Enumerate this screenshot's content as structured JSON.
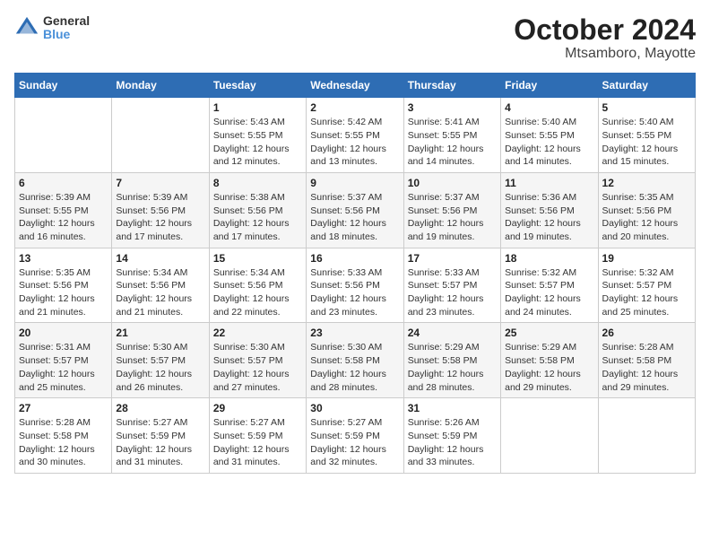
{
  "header": {
    "logo_line1": "General",
    "logo_line2": "Blue",
    "title": "October 2024",
    "subtitle": "Mtsamboro, Mayotte"
  },
  "columns": [
    "Sunday",
    "Monday",
    "Tuesday",
    "Wednesday",
    "Thursday",
    "Friday",
    "Saturday"
  ],
  "weeks": [
    [
      {
        "day": "",
        "info": ""
      },
      {
        "day": "",
        "info": ""
      },
      {
        "day": "1",
        "info": "Sunrise: 5:43 AM\nSunset: 5:55 PM\nDaylight: 12 hours\nand 12 minutes."
      },
      {
        "day": "2",
        "info": "Sunrise: 5:42 AM\nSunset: 5:55 PM\nDaylight: 12 hours\nand 13 minutes."
      },
      {
        "day": "3",
        "info": "Sunrise: 5:41 AM\nSunset: 5:55 PM\nDaylight: 12 hours\nand 14 minutes."
      },
      {
        "day": "4",
        "info": "Sunrise: 5:40 AM\nSunset: 5:55 PM\nDaylight: 12 hours\nand 14 minutes."
      },
      {
        "day": "5",
        "info": "Sunrise: 5:40 AM\nSunset: 5:55 PM\nDaylight: 12 hours\nand 15 minutes."
      }
    ],
    [
      {
        "day": "6",
        "info": "Sunrise: 5:39 AM\nSunset: 5:55 PM\nDaylight: 12 hours\nand 16 minutes."
      },
      {
        "day": "7",
        "info": "Sunrise: 5:39 AM\nSunset: 5:56 PM\nDaylight: 12 hours\nand 17 minutes."
      },
      {
        "day": "8",
        "info": "Sunrise: 5:38 AM\nSunset: 5:56 PM\nDaylight: 12 hours\nand 17 minutes."
      },
      {
        "day": "9",
        "info": "Sunrise: 5:37 AM\nSunset: 5:56 PM\nDaylight: 12 hours\nand 18 minutes."
      },
      {
        "day": "10",
        "info": "Sunrise: 5:37 AM\nSunset: 5:56 PM\nDaylight: 12 hours\nand 19 minutes."
      },
      {
        "day": "11",
        "info": "Sunrise: 5:36 AM\nSunset: 5:56 PM\nDaylight: 12 hours\nand 19 minutes."
      },
      {
        "day": "12",
        "info": "Sunrise: 5:35 AM\nSunset: 5:56 PM\nDaylight: 12 hours\nand 20 minutes."
      }
    ],
    [
      {
        "day": "13",
        "info": "Sunrise: 5:35 AM\nSunset: 5:56 PM\nDaylight: 12 hours\nand 21 minutes."
      },
      {
        "day": "14",
        "info": "Sunrise: 5:34 AM\nSunset: 5:56 PM\nDaylight: 12 hours\nand 21 minutes."
      },
      {
        "day": "15",
        "info": "Sunrise: 5:34 AM\nSunset: 5:56 PM\nDaylight: 12 hours\nand 22 minutes."
      },
      {
        "day": "16",
        "info": "Sunrise: 5:33 AM\nSunset: 5:56 PM\nDaylight: 12 hours\nand 23 minutes."
      },
      {
        "day": "17",
        "info": "Sunrise: 5:33 AM\nSunset: 5:57 PM\nDaylight: 12 hours\nand 23 minutes."
      },
      {
        "day": "18",
        "info": "Sunrise: 5:32 AM\nSunset: 5:57 PM\nDaylight: 12 hours\nand 24 minutes."
      },
      {
        "day": "19",
        "info": "Sunrise: 5:32 AM\nSunset: 5:57 PM\nDaylight: 12 hours\nand 25 minutes."
      }
    ],
    [
      {
        "day": "20",
        "info": "Sunrise: 5:31 AM\nSunset: 5:57 PM\nDaylight: 12 hours\nand 25 minutes."
      },
      {
        "day": "21",
        "info": "Sunrise: 5:30 AM\nSunset: 5:57 PM\nDaylight: 12 hours\nand 26 minutes."
      },
      {
        "day": "22",
        "info": "Sunrise: 5:30 AM\nSunset: 5:57 PM\nDaylight: 12 hours\nand 27 minutes."
      },
      {
        "day": "23",
        "info": "Sunrise: 5:30 AM\nSunset: 5:58 PM\nDaylight: 12 hours\nand 28 minutes."
      },
      {
        "day": "24",
        "info": "Sunrise: 5:29 AM\nSunset: 5:58 PM\nDaylight: 12 hours\nand 28 minutes."
      },
      {
        "day": "25",
        "info": "Sunrise: 5:29 AM\nSunset: 5:58 PM\nDaylight: 12 hours\nand 29 minutes."
      },
      {
        "day": "26",
        "info": "Sunrise: 5:28 AM\nSunset: 5:58 PM\nDaylight: 12 hours\nand 29 minutes."
      }
    ],
    [
      {
        "day": "27",
        "info": "Sunrise: 5:28 AM\nSunset: 5:58 PM\nDaylight: 12 hours\nand 30 minutes."
      },
      {
        "day": "28",
        "info": "Sunrise: 5:27 AM\nSunset: 5:59 PM\nDaylight: 12 hours\nand 31 minutes."
      },
      {
        "day": "29",
        "info": "Sunrise: 5:27 AM\nSunset: 5:59 PM\nDaylight: 12 hours\nand 31 minutes."
      },
      {
        "day": "30",
        "info": "Sunrise: 5:27 AM\nSunset: 5:59 PM\nDaylight: 12 hours\nand 32 minutes."
      },
      {
        "day": "31",
        "info": "Sunrise: 5:26 AM\nSunset: 5:59 PM\nDaylight: 12 hours\nand 33 minutes."
      },
      {
        "day": "",
        "info": ""
      },
      {
        "day": "",
        "info": ""
      }
    ]
  ]
}
